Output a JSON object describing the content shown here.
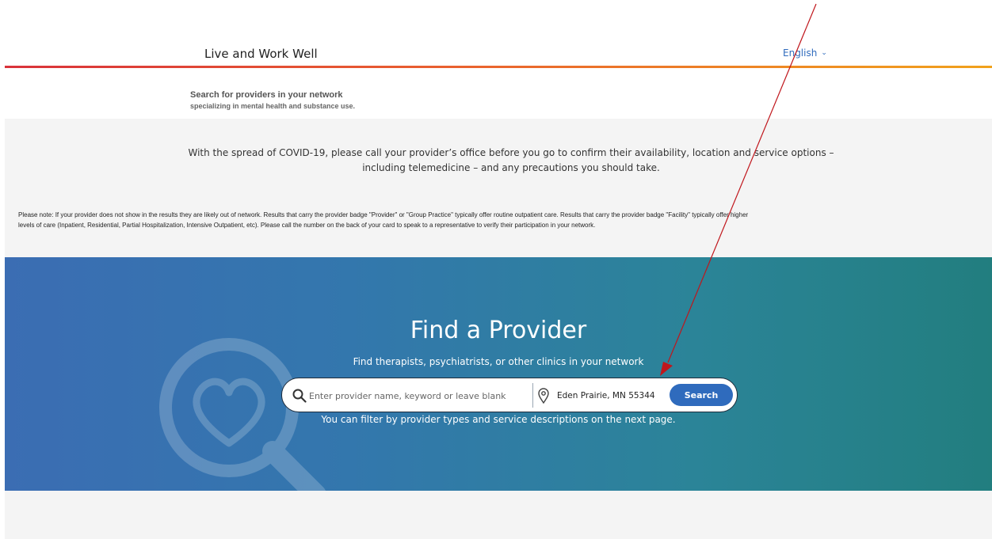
{
  "header": {
    "brand": "Live and Work Well",
    "language": "English"
  },
  "intro": {
    "line1": "Search for providers in your network",
    "line2": "specializing in mental health and substance use."
  },
  "covid_notice": "With the spread of COVID-19, please call your provider’s office before you go to confirm their availability, location and service options – including telemedicine – and any precautions you should take.",
  "network_note": "Please note: If your provider does not show in the results they are likely out of network. Results that carry the provider badge \"Provider\" or \"Group Practice\" typically offer routine outpatient care. Results that carry the provider badge \"Facility\" typically offer higher levels of care (Inpatient, Residential, Partial Hospitalization, Intensive Outpatient, etc). Please call the number on the back of your card to speak to a representative to verify their participation in your network.",
  "hero": {
    "title": "Find a Provider",
    "subtitle": "Find therapists, psychiatrists, or other clinics in your network",
    "search_placeholder": "Enter provider name, keyword or leave blank",
    "location_value": "Eden Prairie, MN 55344",
    "search_button": "Search",
    "footnote": "You can filter by provider types and service descriptions on the next page."
  },
  "icons": {
    "search": "search-icon",
    "location": "location-pin-icon",
    "language_chevron": "chevron-down-icon",
    "hero_illustration": "magnifier-heart-icon"
  },
  "colors": {
    "accent": "#2f6bbd",
    "hero_start": "#3b6db3",
    "hero_end": "#227e7f",
    "annotation_arrow": "#c0161c"
  }
}
